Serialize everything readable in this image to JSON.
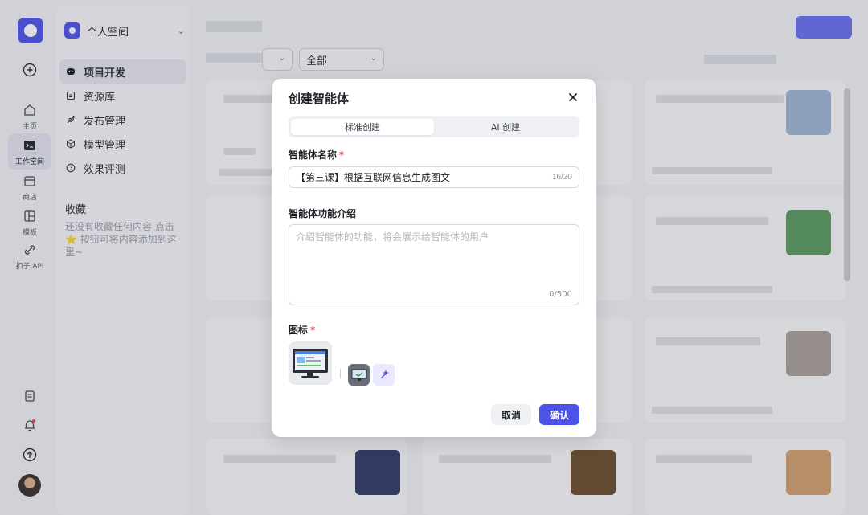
{
  "rail": {
    "items": [
      {
        "label": "主页",
        "icon": "home-icon"
      },
      {
        "label": "工作空间",
        "icon": "terminal-icon"
      },
      {
        "label": "商店",
        "icon": "store-icon"
      },
      {
        "label": "模板",
        "icon": "template-icon"
      },
      {
        "label": "扣子 API",
        "icon": "api-icon"
      }
    ]
  },
  "sidebar": {
    "space_name": "个人空间",
    "nav": [
      {
        "label": "项目开发",
        "icon": "bot-icon"
      },
      {
        "label": "资源库",
        "icon": "library-icon"
      },
      {
        "label": "发布管理",
        "icon": "rocket-icon"
      },
      {
        "label": "模型管理",
        "icon": "cube-icon"
      },
      {
        "label": "效果评测",
        "icon": "gauge-icon"
      }
    ],
    "favorites_title": "收藏",
    "favorites_empty": "还没有收藏任何内容 点击 ⭐ 按钮可将内容添加到这里~"
  },
  "filters": {
    "second_value": "全部"
  },
  "modal": {
    "title": "创建智能体",
    "tabs": [
      "标准创建",
      "AI 创建"
    ],
    "name_label": "智能体名称",
    "name_value": "【第三课】根据互联网信息生成图文",
    "name_count": "16/20",
    "desc_label": "智能体功能介绍",
    "desc_placeholder": "介绍智能体的功能，将会展示给智能体的用户",
    "desc_count": "0/500",
    "icon_label": "图标",
    "required_mark": "*",
    "cancel_label": "取消",
    "confirm_label": "确认"
  },
  "colors": {
    "accent": "#4d53e8",
    "required": "#f54a45"
  }
}
